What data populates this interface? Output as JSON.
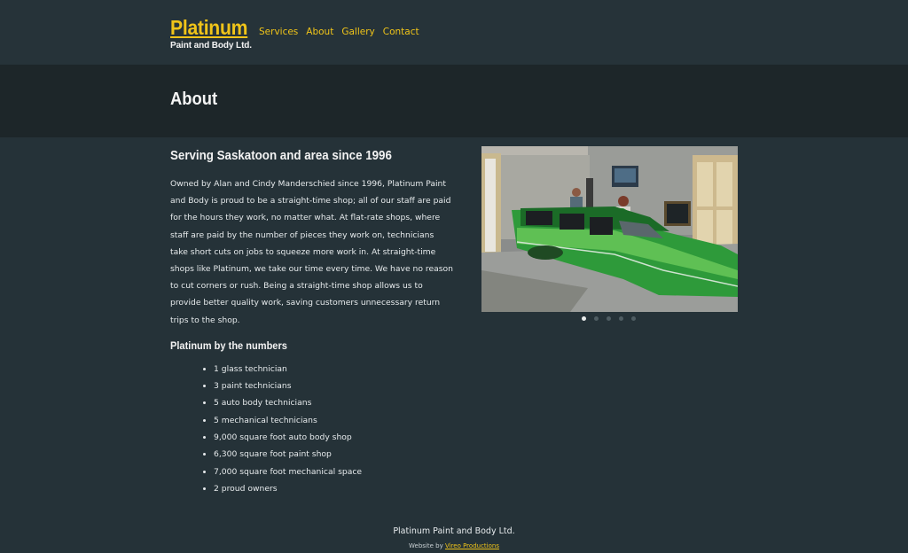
{
  "header": {
    "logo_title": "Platinum",
    "logo_subtitle": "Paint and Body Ltd.",
    "nav": [
      {
        "label": "Services"
      },
      {
        "label": "About"
      },
      {
        "label": "Gallery"
      },
      {
        "label": "Contact"
      }
    ]
  },
  "hero": {
    "title": "About"
  },
  "main": {
    "heading": "Serving Saskatoon and area since 1996",
    "intro": "Owned by Alan and Cindy Manderschied since 1996, Platinum Paint and Body is proud to be a straight-time shop; all of our staff are paid for the hours they work, no matter what. At flat-rate shops, where staff are paid by the number of pieces they work on, technicians take short cuts on jobs to squeeze more work in. At straight-time shops like Platinum, we take our time every time. We have no reason to cut corners or rush. Being a straight-time shop allows us to provide better quality work, saving customers unnecessary return trips to the shop.",
    "numbers_heading": "Platinum by the numbers",
    "numbers": [
      "1 glass technician",
      "3 paint technicians",
      "5 auto body technicians",
      "5 mechanical technicians",
      "9,000 square foot auto body shop",
      "6,300 square foot paint shop",
      "7,000 square foot mechanical space",
      "2 proud owners"
    ]
  },
  "carousel": {
    "slide_count": 5,
    "active_slide": 1
  },
  "footer": {
    "company": "Platinum Paint and Body Ltd.",
    "credit_prefix": "Website by ",
    "credit_link": "Vireo Productions"
  },
  "colors": {
    "background": "#253238",
    "hero": "#1d2629",
    "accent": "#f0c419"
  }
}
